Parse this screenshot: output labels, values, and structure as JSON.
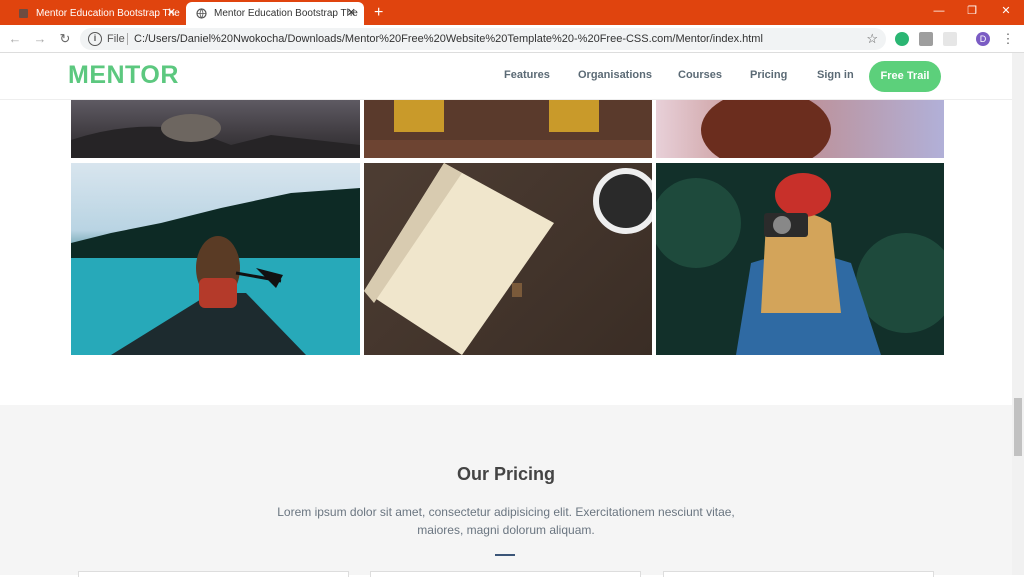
{
  "browser": {
    "tabs": [
      {
        "title": "Mentor Education Bootstrap The",
        "close": "✕"
      },
      {
        "title": "Mentor Education Bootstrap The",
        "close": "✕"
      }
    ],
    "new_tab": "+",
    "window_controls": {
      "minimize": "—",
      "restore": "❐",
      "close": "✕"
    },
    "nav": {
      "back": "←",
      "forward": "→",
      "reload": "↻"
    },
    "address": {
      "label": "File",
      "url": "C:/Users/Daniel%20Nwokocha/Downloads/Mentor%20Free%20Website%20Template%20-%20Free-CSS.com/Mentor/index.html"
    },
    "star": "☆",
    "profile_initial": "D",
    "menu": "⋮"
  },
  "site": {
    "logo": "MENTOR",
    "nav_links": [
      "Features",
      "Organisations",
      "Courses",
      "Pricing",
      "Sign in"
    ],
    "cta": "Free Trail"
  },
  "gallery": {
    "photos": [
      {
        "subject": "rocky coast under dark clouds"
      },
      {
        "subject": "brick building with lit windows"
      },
      {
        "subject": "woman with red hair"
      },
      {
        "subject": "woman in canoe on turquoise lake"
      },
      {
        "subject": "open notebook and coffee cup on wooden table"
      },
      {
        "subject": "woman in red beanie with camera"
      }
    ]
  },
  "pricing": {
    "title": "Our Pricing",
    "description": "Lorem ipsum dolor sit amet, consectetur adipisicing elit. Exercitationem nesciunt vitae, maiores, magni dolorum aliquam."
  },
  "colors": {
    "tabbar": "#e0440e",
    "brand_green": "#5cc87f",
    "cta_green": "#5cd07b",
    "nav_text": "#5b6a75",
    "accent_line": "#3b5578"
  }
}
